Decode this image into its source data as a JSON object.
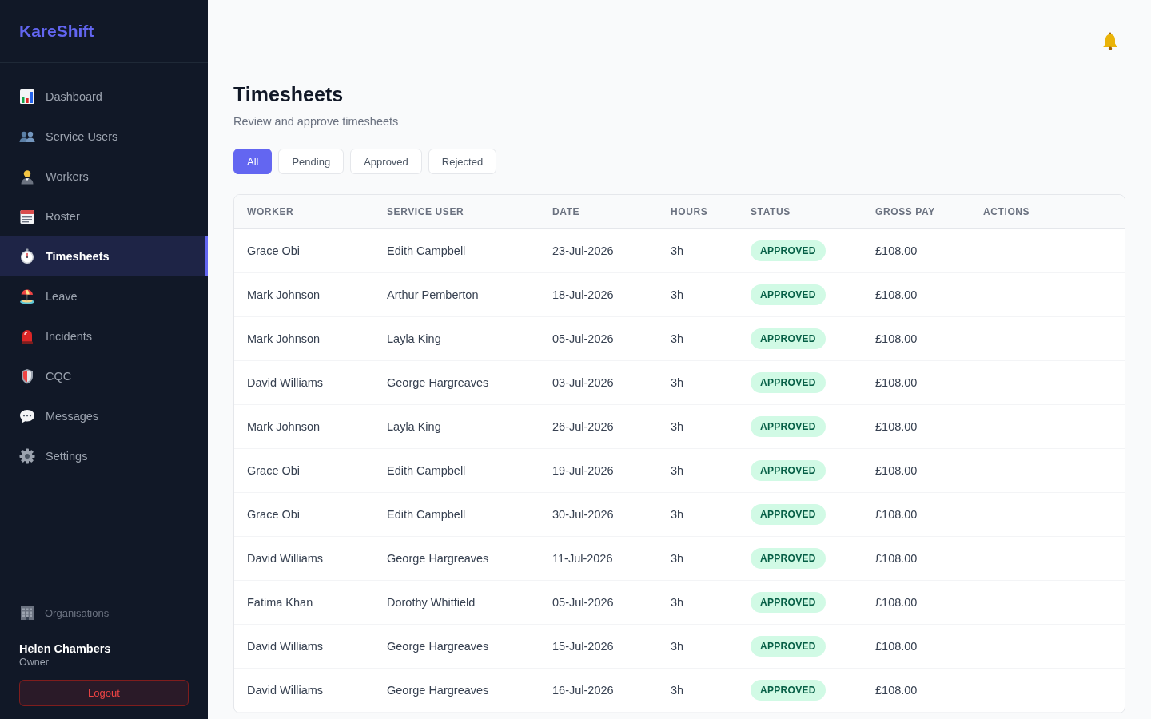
{
  "sidebar": {
    "logo": "KareShift",
    "items": [
      {
        "label": "Dashboard",
        "selected": false
      },
      {
        "label": "Service Users",
        "selected": false
      },
      {
        "label": "Workers",
        "selected": false
      },
      {
        "label": "Roster",
        "selected": false
      },
      {
        "label": "Timesheets",
        "selected": true
      },
      {
        "label": "Leave",
        "selected": false
      },
      {
        "label": "Incidents",
        "selected": false
      },
      {
        "label": "CQC",
        "selected": false
      },
      {
        "label": "Messages",
        "selected": false
      },
      {
        "label": "Settings",
        "selected": false
      }
    ],
    "organisations_link": "Organisations",
    "user": {
      "name": "Helen Chambers",
      "role": "Owner"
    },
    "logout_button": "Logout"
  },
  "page": {
    "title": "Timesheets",
    "subtitle": "Review and approve timesheets"
  },
  "filters": [
    {
      "label": "All",
      "selected": true
    },
    {
      "label": "Pending",
      "selected": false
    },
    {
      "label": "Approved",
      "selected": false
    },
    {
      "label": "Rejected",
      "selected": false
    }
  ],
  "table": {
    "columns": [
      "WORKER",
      "SERVICE USER",
      "DATE",
      "HOURS",
      "STATUS",
      "GROSS PAY",
      "ACTIONS"
    ],
    "rows": [
      {
        "worker": "Grace Obi",
        "service_user": "Edith Campbell",
        "date": "23-Jul-2026",
        "hours": "3h",
        "status": {
          "label": "APPROVED",
          "kind": "approved"
        },
        "gross_pay": "£108.00"
      },
      {
        "worker": "Mark Johnson",
        "service_user": "Arthur Pemberton",
        "date": "18-Jul-2026",
        "hours": "3h",
        "status": {
          "label": "APPROVED",
          "kind": "approved"
        },
        "gross_pay": "£108.00"
      },
      {
        "worker": "Mark Johnson",
        "service_user": "Layla King",
        "date": "05-Jul-2026",
        "hours": "3h",
        "status": {
          "label": "APPROVED",
          "kind": "approved"
        },
        "gross_pay": "£108.00"
      },
      {
        "worker": "David Williams",
        "service_user": "George Hargreaves",
        "date": "03-Jul-2026",
        "hours": "3h",
        "status": {
          "label": "APPROVED",
          "kind": "approved"
        },
        "gross_pay": "£108.00"
      },
      {
        "worker": "Mark Johnson",
        "service_user": "Layla King",
        "date": "26-Jul-2026",
        "hours": "3h",
        "status": {
          "label": "APPROVED",
          "kind": "approved"
        },
        "gross_pay": "£108.00"
      },
      {
        "worker": "Grace Obi",
        "service_user": "Edith Campbell",
        "date": "19-Jul-2026",
        "hours": "3h",
        "status": {
          "label": "APPROVED",
          "kind": "approved"
        },
        "gross_pay": "£108.00"
      },
      {
        "worker": "Grace Obi",
        "service_user": "Edith Campbell",
        "date": "30-Jul-2026",
        "hours": "3h",
        "status": {
          "label": "APPROVED",
          "kind": "approved"
        },
        "gross_pay": "£108.00"
      },
      {
        "worker": "David Williams",
        "service_user": "George Hargreaves",
        "date": "11-Jul-2026",
        "hours": "3h",
        "status": {
          "label": "APPROVED",
          "kind": "approved"
        },
        "gross_pay": "£108.00"
      },
      {
        "worker": "Fatima Khan",
        "service_user": "Dorothy Whitfield",
        "date": "05-Jul-2026",
        "hours": "3h",
        "status": {
          "label": "APPROVED",
          "kind": "approved"
        },
        "gross_pay": "£108.00"
      },
      {
        "worker": "David Williams",
        "service_user": "George Hargreaves",
        "date": "15-Jul-2026",
        "hours": "3h",
        "status": {
          "label": "APPROVED",
          "kind": "approved"
        },
        "gross_pay": "£108.00"
      },
      {
        "worker": "David Williams",
        "service_user": "George Hargreaves",
        "date": "16-Jul-2026",
        "hours": "3h",
        "status": {
          "label": "APPROVED",
          "kind": "approved"
        },
        "gross_pay": "£108.00"
      }
    ]
  }
}
